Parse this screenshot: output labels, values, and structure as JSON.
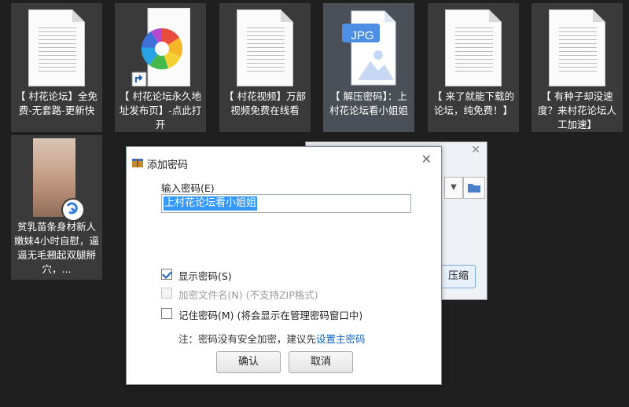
{
  "desktop_files": [
    {
      "label": "【 村花论坛】全免费-无套路-更新快",
      "icon": "document-icon"
    },
    {
      "label": "【 村花论坛永久地址发布页】-点此打开",
      "icon": "pinwheel-shortcut-icon"
    },
    {
      "label": "【 村花视频】万部视频免费在线看",
      "icon": "document-icon"
    },
    {
      "label": "【 解压密码】：上村花论坛看小姐姐",
      "icon": "jpg-file-icon",
      "badge": "JPG"
    },
    {
      "label": "【 来了就能下载的论坛，纯免费！】",
      "icon": "document-icon"
    },
    {
      "label": "【 有种子却没速度？来村花论坛人工加速】",
      "icon": "document-icon"
    }
  ],
  "photo_file": {
    "label": "贫乳苗条身材新人嫩妹4小时自慰，逼逼无毛翘起双腿掰穴，..."
  },
  "background_dialog": {
    "button_label": "压缩"
  },
  "dialog": {
    "title": "添加密码",
    "password_label": "输入密码(E)",
    "password_value": "上村花论坛看小姐姐",
    "show_password": {
      "label": "显示密码(S)",
      "checked": true
    },
    "encrypt_filename": {
      "label": "加密文件名(N) (不支持ZIP格式)",
      "checked": false,
      "disabled": true
    },
    "remember_password": {
      "label": "记住密码(M) (将会显示在管理密码窗口中)",
      "checked": false
    },
    "note_prefix": "注：密码没有安全加密，建议先",
    "note_link": "设置主密码",
    "ok_label": "确认",
    "cancel_label": "取消",
    "close_glyph": "✕"
  }
}
